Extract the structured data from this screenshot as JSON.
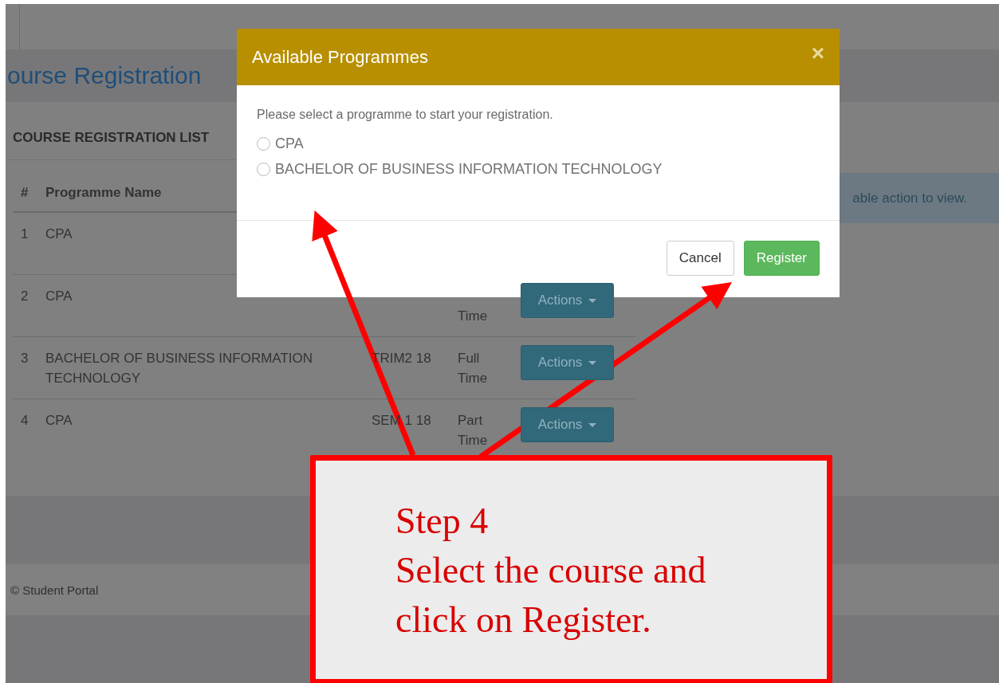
{
  "page_header": {
    "title": "ourse Registration"
  },
  "panel": {
    "title": "COURSE REGISTRATION LIST",
    "table": {
      "columns": [
        "#",
        "Programme Name"
      ],
      "rows": [
        {
          "index": "1",
          "programme": "CPA"
        },
        {
          "index": "2",
          "programme": "CPA",
          "mode": "Time",
          "action": "Actions"
        },
        {
          "index": "3",
          "programme": "BACHELOR OF BUSINESS INFORMATION TECHNOLOGY",
          "code": "TRIM2 18",
          "mode": "Full Time",
          "action": "Actions"
        },
        {
          "index": "4",
          "programme": "CPA",
          "code": "SEM 1 18",
          "mode": "Part Time",
          "action": "Actions"
        }
      ]
    }
  },
  "info_alert": {
    "text": "able action to view."
  },
  "footer": {
    "text": "© Student Portal"
  },
  "modal": {
    "title": "Available Programmes",
    "close": "×",
    "prompt": "Please select a programme to start your registration.",
    "options": [
      {
        "label": "CPA",
        "selected": false
      },
      {
        "label": "BACHELOR OF BUSINESS INFORMATION TECHNOLOGY",
        "selected": false
      }
    ],
    "buttons": [
      {
        "label": "Cancel",
        "kind": "default"
      },
      {
        "label": "Register",
        "kind": "primary"
      }
    ]
  },
  "annotation": {
    "lines": [
      "Step 4",
      "Select the course and",
      "click on Register."
    ]
  }
}
